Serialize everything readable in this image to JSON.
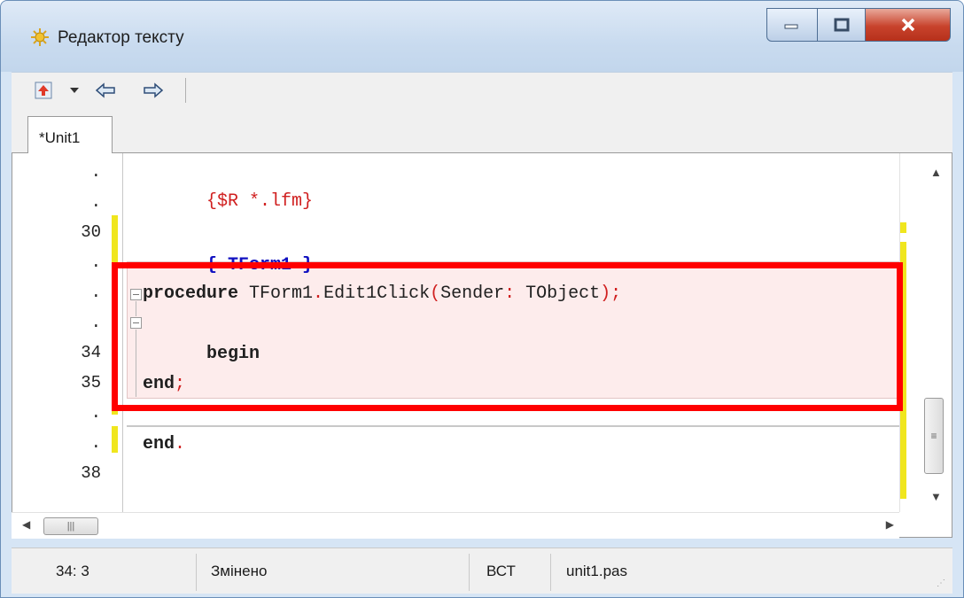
{
  "window": {
    "title": "Редактор тексту"
  },
  "tabs": [
    {
      "label": "*Unit1"
    }
  ],
  "gutter": {
    "lines": [
      ".",
      ".",
      "30",
      ".",
      ".",
      ".",
      "34",
      "35",
      ".",
      ".",
      "38"
    ]
  },
  "code": {
    "directive": "{$R *.lfm}",
    "class_comment": "{ TForm1 }",
    "proc_keyword": "procedure",
    "proc_name": " TForm1",
    "proc_dot": ".",
    "proc_method": "Edit1Click",
    "proc_paren_open": "(",
    "proc_param": "Sender",
    "proc_colon": ":",
    "proc_type": " TObject",
    "proc_close": ");",
    "begin": "begin",
    "end_kw": "end",
    "end_semi": ";",
    "final_end": "end",
    "final_dot": "."
  },
  "statusbar": {
    "position": "34: 3",
    "state": "Змінено",
    "mode": "ВСТ",
    "filename": "unit1.pas"
  },
  "colors": {
    "highlight_frame": "#ff0000",
    "modified_marker": "#f0e61e",
    "keyword_red": "#d02020",
    "comment_blue": "#1010c0"
  }
}
